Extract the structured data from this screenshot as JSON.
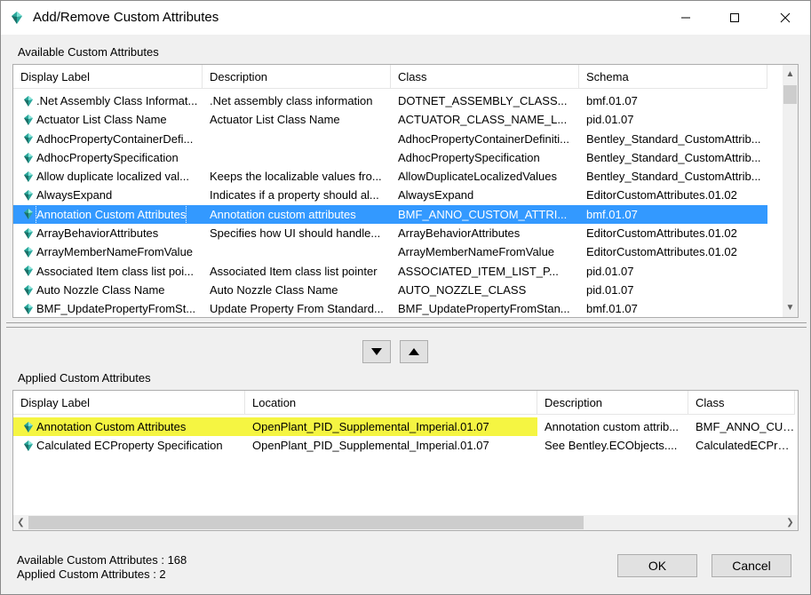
{
  "window": {
    "title": "Add/Remove Custom Attributes"
  },
  "available": {
    "group_label": "Available Custom Attributes",
    "columns": [
      "Display Label",
      "Description",
      "Class",
      "Schema"
    ],
    "rows": [
      [
        ".Net Assembly Class Informat...",
        ".Net assembly class information",
        "DOTNET_ASSEMBLY_CLASS...",
        "bmf.01.07"
      ],
      [
        "Actuator List Class Name",
        "Actuator List Class Name",
        "ACTUATOR_CLASS_NAME_L...",
        "pid.01.07"
      ],
      [
        "AdhocPropertyContainerDefi...",
        "",
        "AdhocPropertyContainerDefiniti...",
        "Bentley_Standard_CustomAttrib..."
      ],
      [
        "AdhocPropertySpecification",
        "",
        "AdhocPropertySpecification",
        "Bentley_Standard_CustomAttrib..."
      ],
      [
        "Allow duplicate localized val...",
        "Keeps the localizable values fro...",
        "AllowDuplicateLocalizedValues",
        "Bentley_Standard_CustomAttrib..."
      ],
      [
        "AlwaysExpand",
        "Indicates if a property should al...",
        "AlwaysExpand",
        "EditorCustomAttributes.01.02"
      ],
      [
        "Annotation Custom Attributes",
        "Annotation custom attributes",
        "BMF_ANNO_CUSTOM_ATTRI...",
        "bmf.01.07"
      ],
      [
        "ArrayBehaviorAttributes",
        "Specifies how UI should handle...",
        "ArrayBehaviorAttributes",
        "EditorCustomAttributes.01.02"
      ],
      [
        "ArrayMemberNameFromValue",
        "",
        "ArrayMemberNameFromValue",
        "EditorCustomAttributes.01.02"
      ],
      [
        "Associated Item class list poi...",
        "Associated Item class list pointer",
        "ASSOCIATED_ITEM_LIST_P...",
        "pid.01.07"
      ],
      [
        "Auto Nozzle Class Name",
        "Auto Nozzle Class Name",
        "AUTO_NOZZLE_CLASS",
        "pid.01.07"
      ],
      [
        "BMF_UpdatePropertyFromSt...",
        "Update Property From Standard...",
        "BMF_UpdatePropertyFromStan...",
        "bmf.01.07"
      ]
    ],
    "selected_index": 6
  },
  "applied": {
    "group_label": "Applied Custom Attributes",
    "columns": [
      "Display Label",
      "Location",
      "Description",
      "Class"
    ],
    "rows": [
      [
        "Annotation Custom Attributes",
        "OpenPlant_PID_Supplemental_Imperial.01.07",
        "Annotation custom attrib...",
        "BMF_ANNO_CUST"
      ],
      [
        "Calculated ECProperty Specification",
        "OpenPlant_PID_Supplemental_Imperial.01.07",
        "See Bentley.ECObjects....",
        "CalculatedECProper"
      ]
    ]
  },
  "status": {
    "available_count": "Available Custom Attributes : 168",
    "applied_count": "Applied Custom Attributes : 2"
  },
  "buttons": {
    "ok": "OK",
    "cancel": "Cancel"
  },
  "icons": {
    "row_icon": "attribute-gem-icon",
    "highlight_color": "#f5f542",
    "selection_color": "#3399ff",
    "gem_color": "#2aa79b"
  }
}
